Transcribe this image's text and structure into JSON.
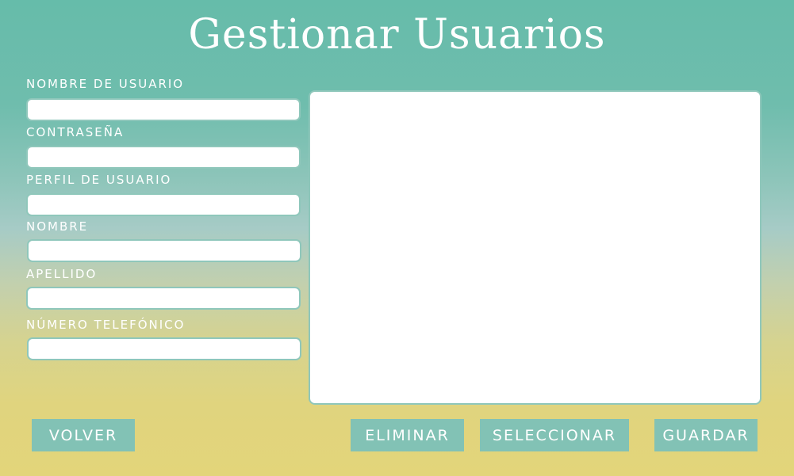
{
  "header": {
    "title": "Gestionar Usuarios"
  },
  "form": {
    "fields": [
      {
        "label": "NOMBRE DE USUARIO",
        "value": ""
      },
      {
        "label": "CONTRASEÑA",
        "value": ""
      },
      {
        "label": "PERFIL DE USUARIO",
        "value": ""
      },
      {
        "label": "NOMBRE",
        "value": ""
      },
      {
        "label": "APELLIDO",
        "value": ""
      },
      {
        "label": "NÚMERO TELEFÓNICO",
        "value": ""
      }
    ]
  },
  "buttons": {
    "back": "VOLVER",
    "delete": "ELIMINAR",
    "select": "SELECCIONAR",
    "save": "GUARDAR"
  },
  "colors": {
    "accent": "#82c2b5",
    "top": "#66bcaa",
    "bottom": "#e3d57a"
  }
}
